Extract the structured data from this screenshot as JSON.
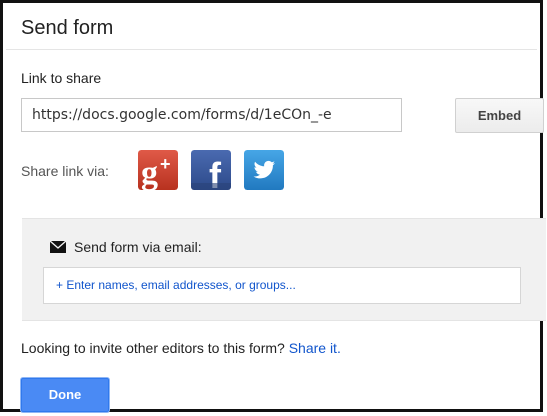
{
  "dialog": {
    "title": "Send form",
    "link_label": "Link to share",
    "link_value": "https://docs.google.com/forms/d/1eCOn_-e",
    "embed_label": "Embed",
    "share_label": "Share link via:",
    "social": [
      {
        "name": "google-plus-icon",
        "glyph": "g+",
        "color": "#d34836"
      },
      {
        "name": "facebook-icon",
        "glyph": "f",
        "color": "#3b5998"
      },
      {
        "name": "twitter-icon",
        "glyph": "bird",
        "color": "#2f8bd2"
      }
    ],
    "email_heading": "Send form via email:",
    "email_placeholder": "+ Enter names, email addresses, or groups...",
    "invite_text": "Looking to invite other editors to this form?",
    "invite_link": "Share it.",
    "done_label": "Done"
  },
  "colors": {
    "primary_button": "#4a8af4",
    "link": "#1155cc",
    "panel_bg": "#f1f1f1"
  }
}
